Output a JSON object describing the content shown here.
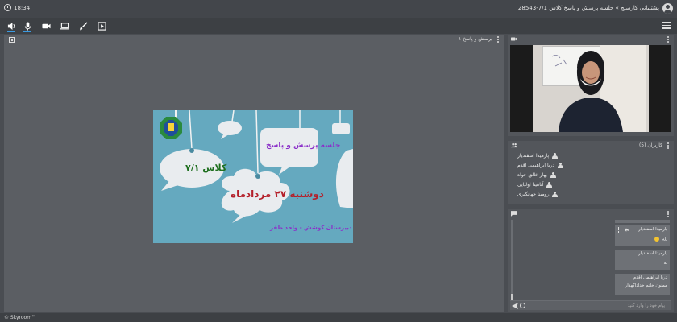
{
  "header": {
    "time": "18:34",
    "title": "پشتیبانی کارسنج » جلسه پرسش و پاسخ کلاس 7/1-28543"
  },
  "toolbar": {
    "icons": [
      "speaker-icon",
      "microphone-icon",
      "camera-icon",
      "screen-share-icon",
      "brush-icon",
      "slide-icon"
    ],
    "active_colors": "#3b9ae1"
  },
  "stage": {
    "label": "پرسش و پاسخ ۱",
    "slide": {
      "line1": "جلسه پرسش و پاسخ",
      "line2": "کلاس ۷/۱",
      "line3": "دوشنبه ۲۷ مردادماه",
      "line4": "دبیرستان کوشش - واحد ظفر"
    }
  },
  "users": {
    "label": "کاربران (5)",
    "list": [
      "پارمیدا اسفندیار",
      "دریا ابراهیمی اقدم",
      "بهار خالق خواه",
      "آناهیتا اولیایی",
      "رومینا جهانگیری"
    ]
  },
  "chat": {
    "messages": [
      {
        "who": "پارمیدا اسفندیار",
        "text": "بله"
      },
      {
        "who": "پارمیدا اسفندیار",
        "text": "نه"
      },
      {
        "who": "دریا ابراهیمی اقدم",
        "text": "ممنون خانم خداداگهدار"
      }
    ],
    "placeholder": "پیام خود را وارد کنید"
  },
  "footer": {
    "brand": "© Skyroom™"
  }
}
